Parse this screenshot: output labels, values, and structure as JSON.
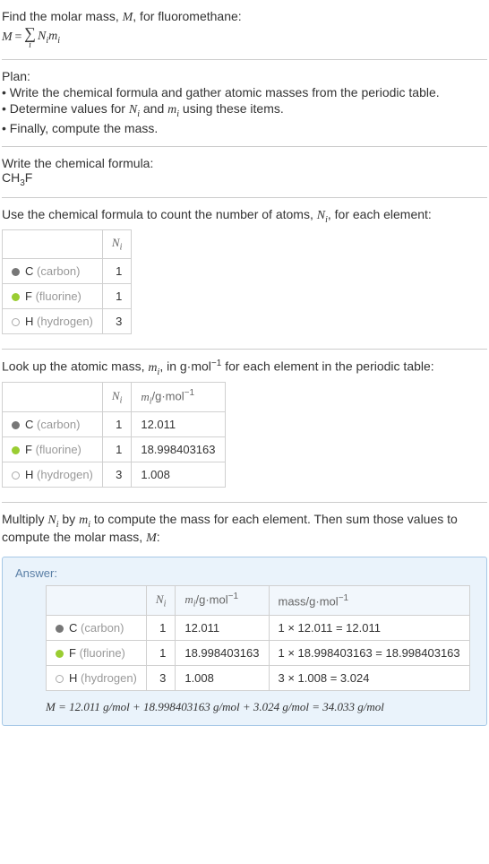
{
  "intro": {
    "line1": "Find the molar mass, M, for fluoromethane:",
    "eq_lhs": "M",
    "eq_eq": " = ",
    "sigma_sub": "i",
    "term_N": "N",
    "term_N_sub": "i",
    "term_m": "m",
    "term_m_sub": "i"
  },
  "plan": {
    "heading": "Plan:",
    "items": [
      "Write the chemical formula and gather atomic masses from the periodic table.",
      "Determine values for N_i and m_i using these items.",
      "Finally, compute the mass."
    ]
  },
  "step_formula": {
    "heading": "Write the chemical formula:",
    "formula_parts": {
      "p1": "CH",
      "sub1": "3",
      "p2": "F"
    }
  },
  "step_count": {
    "heading": "Use the chemical formula to count the number of atoms, N_i, for each element:",
    "header_Ni": "N_i",
    "rows": [
      {
        "sym": "C",
        "name": "(carbon)",
        "dot": "dot-c",
        "n": "1"
      },
      {
        "sym": "F",
        "name": "(fluorine)",
        "dot": "dot-f",
        "n": "1"
      },
      {
        "sym": "H",
        "name": "(hydrogen)",
        "dot": "dot-h",
        "n": "3"
      }
    ]
  },
  "step_mass": {
    "heading_pre": "Look up the atomic mass, m_i, in g·mol",
    "heading_exp": "−1",
    "heading_post": " for each element in the periodic table:",
    "header_Ni": "N_i",
    "header_mi_pre": "m_i/g·mol",
    "header_mi_exp": "−1",
    "rows": [
      {
        "sym": "C",
        "name": "(carbon)",
        "dot": "dot-c",
        "n": "1",
        "m": "12.011"
      },
      {
        "sym": "F",
        "name": "(fluorine)",
        "dot": "dot-f",
        "n": "1",
        "m": "18.998403163"
      },
      {
        "sym": "H",
        "name": "(hydrogen)",
        "dot": "dot-h",
        "n": "3",
        "m": "1.008"
      }
    ]
  },
  "step_multiply": {
    "heading": "Multiply N_i by m_i to compute the mass for each element. Then sum those values to compute the molar mass, M:"
  },
  "answer": {
    "label": "Answer:",
    "header_Ni": "N_i",
    "header_mi_pre": "m_i/g·mol",
    "header_mi_exp": "−1",
    "header_mass_pre": "mass/g·mol",
    "header_mass_exp": "−1",
    "rows": [
      {
        "sym": "C",
        "name": "(carbon)",
        "dot": "dot-c",
        "n": "1",
        "m": "12.011",
        "mass": "1 × 12.011 = 12.011"
      },
      {
        "sym": "F",
        "name": "(fluorine)",
        "dot": "dot-f",
        "n": "1",
        "m": "18.998403163",
        "mass": "1 × 18.998403163 = 18.998403163"
      },
      {
        "sym": "H",
        "name": "(hydrogen)",
        "dot": "dot-h",
        "n": "3",
        "m": "1.008",
        "mass": "3 × 1.008 = 3.024"
      }
    ],
    "final": "M = 12.011 g/mol + 18.998403163 g/mol + 3.024 g/mol = 34.033 g/mol"
  }
}
